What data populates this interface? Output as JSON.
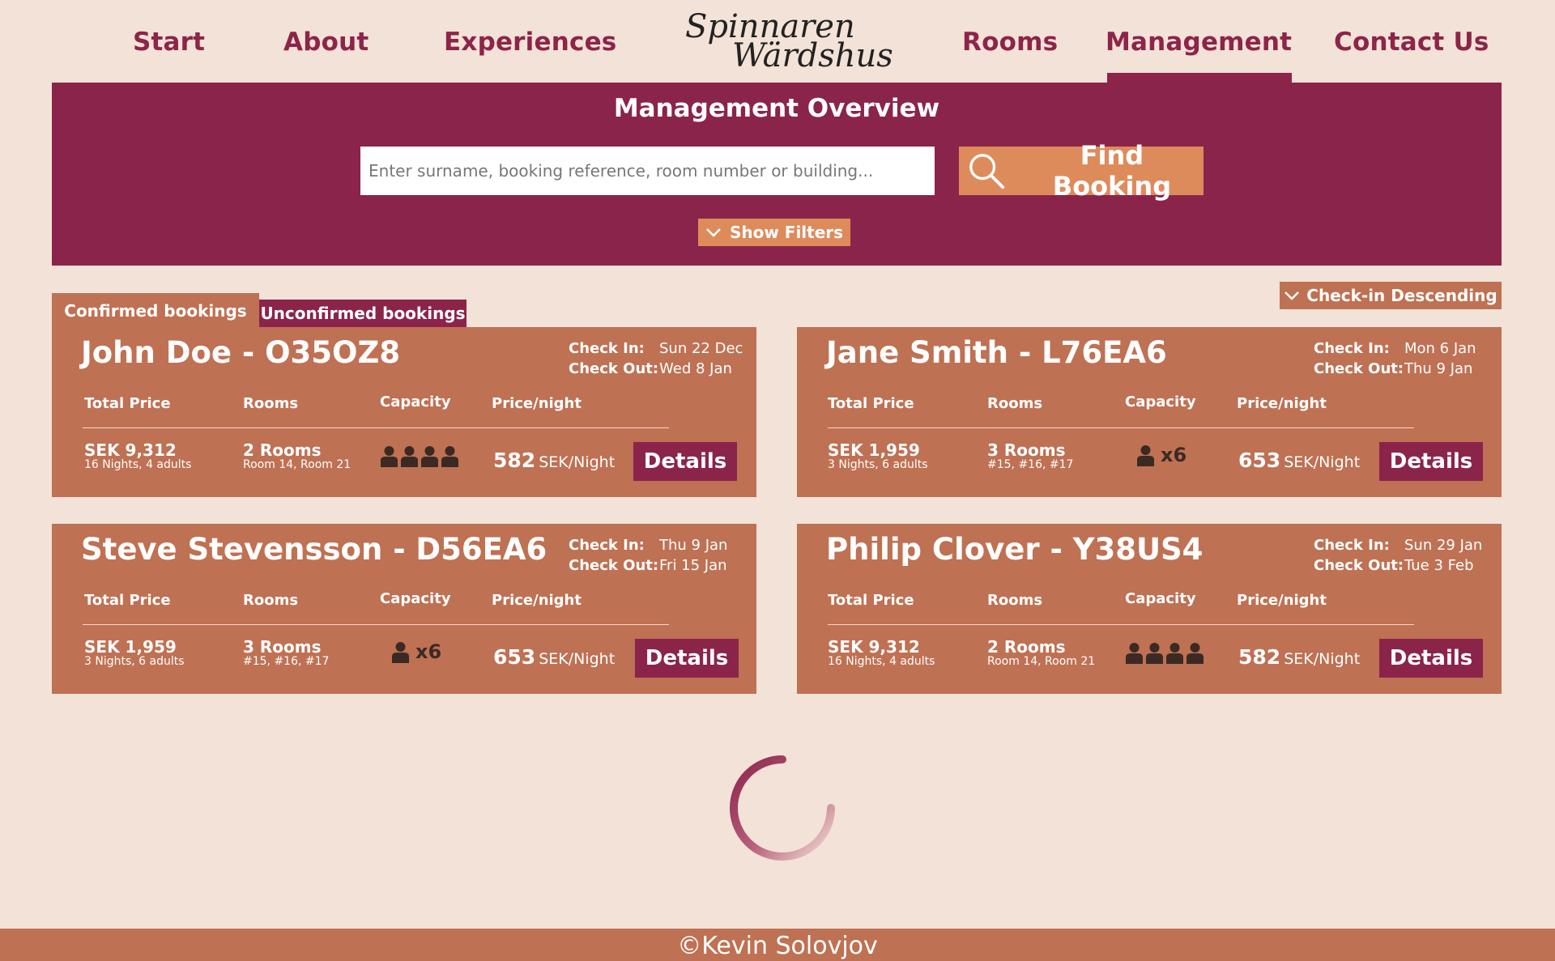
{
  "nav": {
    "items": [
      {
        "label": "Start"
      },
      {
        "label": "About"
      },
      {
        "label": "Experiences"
      },
      {
        "label": "Rooms"
      },
      {
        "label": "Management",
        "active": true
      },
      {
        "label": "Contact Us"
      }
    ],
    "logo": {
      "line1": "Spinnaren",
      "line2": "Wärdshus"
    }
  },
  "hero": {
    "title": "Management Overview",
    "search_placeholder": "Enter surname, booking reference, room number or building...",
    "find_label": "Find Booking",
    "filters_label": "Show Filters"
  },
  "sort": {
    "label": "Check-in Descending"
  },
  "tabs": {
    "confirmed": "Confirmed bookings",
    "unconfirmed": "Unconfirmed bookings"
  },
  "columns": {
    "total": "Total Price",
    "rooms": "Rooms",
    "capacity": "Capacity",
    "price": "Price/night"
  },
  "labels": {
    "check_in": "Check In:",
    "check_out": "Check Out:",
    "details": "Details",
    "per_night_unit": "SEK/Night"
  },
  "bookings": [
    {
      "title": "John Doe - O35OZ8",
      "check_in": "Sun 22 Dec",
      "check_out": "Wed 8 Jan",
      "total": "SEK 9,312",
      "total_sub": "16 Nights, 4 adults",
      "rooms": "2 Rooms",
      "rooms_sub": "Room 14, Room 21",
      "capacity_count": "",
      "price": "582"
    },
    {
      "title": "Jane Smith - L76EA6",
      "check_in": "Mon 6 Jan",
      "check_out": "Thu 9 Jan",
      "total": "SEK 1,959",
      "total_sub": "3 Nights, 6 adults",
      "rooms": "3 Rooms",
      "rooms_sub": "#15, #16, #17",
      "capacity_count": "x6",
      "price": "653"
    },
    {
      "title": "Steve Stevensson - D56EA6",
      "check_in": "Thu 9 Jan",
      "check_out": "Fri 15 Jan",
      "total": "SEK 1,959",
      "total_sub": "3 Nights, 6 adults",
      "rooms": "3 Rooms",
      "rooms_sub": "#15, #16, #17",
      "capacity_count": "x6",
      "price": "653"
    },
    {
      "title": "Philip Clover - Y38US4",
      "check_in": "Sun 29 Jan",
      "check_out": "Tue 3 Feb",
      "total": "SEK 9,312",
      "total_sub": "16 Nights, 4 adults",
      "rooms": "2 Rooms",
      "rooms_sub": "Room 14, Room 21",
      "capacity_count": "",
      "price": "582"
    }
  ],
  "footer": {
    "text": "©Kevin Solovjov"
  },
  "colors": {
    "primary": "#8b244a",
    "card": "#bf7153",
    "accent": "#de8b5b",
    "background": "#f3e2d7"
  }
}
